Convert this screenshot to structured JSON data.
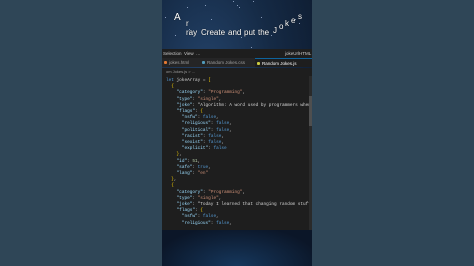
{
  "overlay": {
    "title_words": [
      "A",
      "r",
      "ray",
      "Create",
      "and",
      "put",
      "the",
      "J",
      "o",
      "k",
      "e",
      "s"
    ]
  },
  "menubar": {
    "items": [
      "Selection",
      "View",
      "…",
      "jokeUrlHTML ..."
    ]
  },
  "tabs": [
    {
      "label": "jokes.html",
      "active": false,
      "color": "#e37933"
    },
    {
      "label": "Random Jokes.css",
      "active": false,
      "color": "#519aba"
    },
    {
      "label": "Random Jokes.js",
      "active": true,
      "color": "#cbcb41"
    }
  ],
  "breadcrumb": "om Jokes.js > ...",
  "code_lines": [
    "let jokeArray = [",
    "  {",
    "    \"category\": \"Programming\",",
    "    \"type\": \"single\",",
    "    \"joke\": \"Algorithm: A word used by programmers when",
    "    \"flags\": {",
    "      \"nsfw\": false,",
    "      \"religious\": false,",
    "      \"political\": false,",
    "      \"racist\": false,",
    "      \"sexist\": false,",
    "      \"explicit\": false",
    "    },",
    "    \"id\": 51,",
    "    \"safe\": true,",
    "    \"lang\": \"en\"",
    "  },",
    "  {",
    "    \"category\": \"Programming\",",
    "    \"type\": \"single\",",
    "    \"joke\": \"Today I learned that changing random stuff",
    "    \"flags\": {",
    "      \"nsfw\": false,",
    "      \"religious\": false,"
  ],
  "colors": {
    "keyword": "#569cd6",
    "property": "#9cdcfe",
    "string": "#ce9178",
    "number": "#b5cea8",
    "editor_bg": "#1e1e1e"
  }
}
